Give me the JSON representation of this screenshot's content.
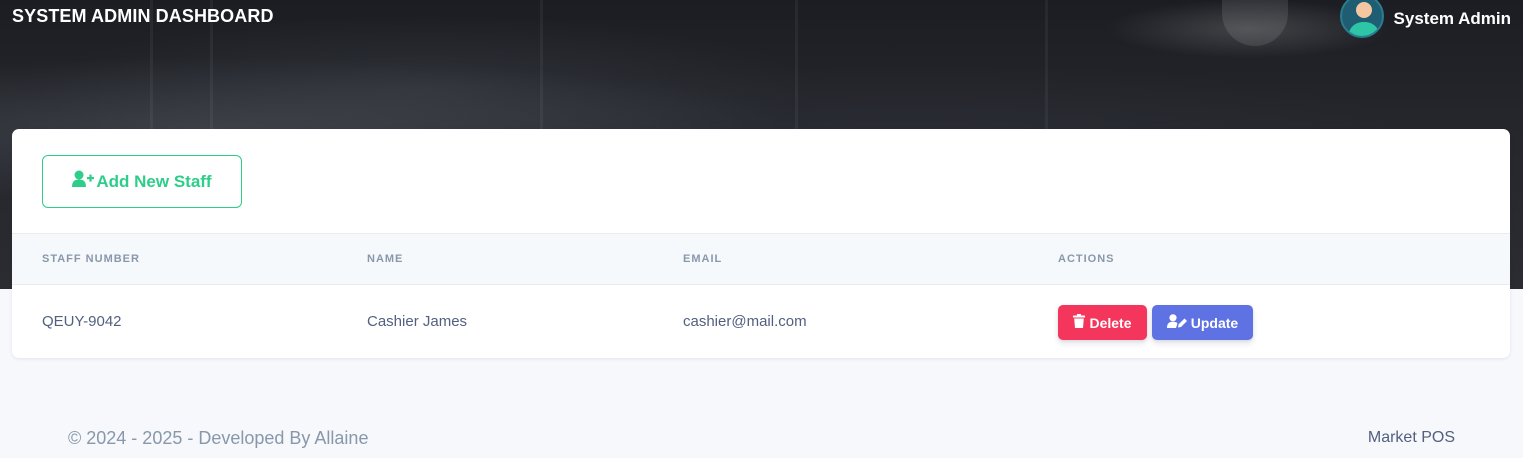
{
  "header": {
    "title": "SYSTEM ADMIN DASHBOARD",
    "user_name": "System Admin",
    "avatar_icon": "user-avatar-icon"
  },
  "staff": {
    "add_button_label": "Add New Staff",
    "add_button_icon": "user-plus-icon",
    "columns": [
      "STAFF NUMBER",
      "NAME",
      "EMAIL",
      "ACTIONS"
    ],
    "rows": [
      {
        "staff_number": "QEUY-9042",
        "name": "Cashier James",
        "email": "cashier@mail.com",
        "delete_label": "Delete",
        "update_label": "Update"
      }
    ]
  },
  "footer": {
    "copyright": "© 2024 - 2025 - Developed By Allaine",
    "app_name": "Market POS"
  },
  "colors": {
    "success": "#2dce89",
    "danger": "#f5365c",
    "primary": "#5e72e4",
    "muted_text": "#8898aa",
    "body_text": "#525f7f"
  }
}
